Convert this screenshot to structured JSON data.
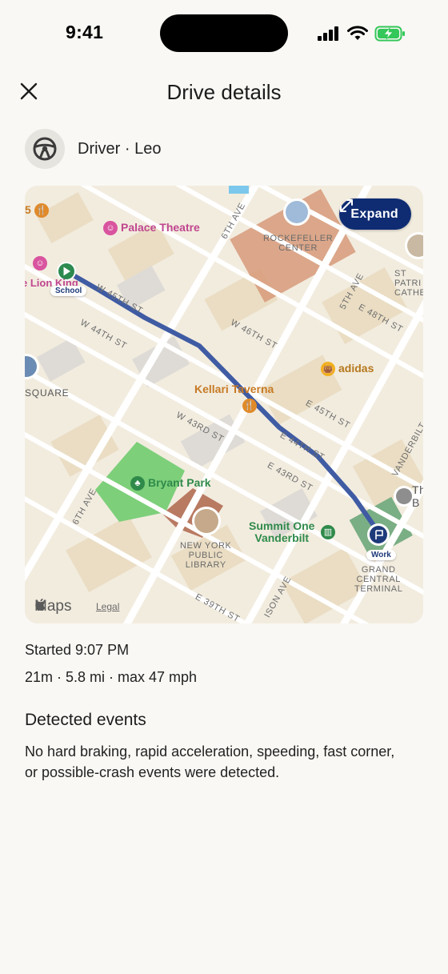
{
  "status_bar": {
    "time": "9:41"
  },
  "header": {
    "title": "Drive details"
  },
  "driver": {
    "label": "Driver · Leo"
  },
  "map": {
    "expand_label": "Expand",
    "brand": "Maps",
    "legal": "Legal",
    "route_color": "#3f5ba3",
    "streets": {
      "w45": "W 45TH ST",
      "w44": "W 44TH ST",
      "w46": "W 46TH ST",
      "e48": "E 48TH ST",
      "e45": "E 45TH ST",
      "e44": "E 44TH ST",
      "e43": "E 43RD ST",
      "w43": "W 43RD ST",
      "e39": "E 39TH ST",
      "ave6_top": "6TH AVE",
      "ave6_bottom": "6TH AVE",
      "ave5": "5TH AVE",
      "vanderbilt": "VANDERBILT AVE",
      "madison": "ISON AVE"
    },
    "pois": {
      "palace": "Palace Theatre",
      "kellari": "Kellari Taverna",
      "adidas": "adidas",
      "bryant": "Bryant Park",
      "summit_line1": "Summit One",
      "summit_line2": "Vanderbilt",
      "lion_king": "e Lion King",
      "left_five": "5",
      "square": "SQUARE"
    },
    "landmarks": {
      "rockefeller_1": "ROCKEFELLER",
      "rockefeller_2": "CENTER",
      "nypl_1": "NEW YORK",
      "nypl_2": "PUBLIC",
      "nypl_3": "LIBRARY",
      "gct_1": "GRAND",
      "gct_2": "CENTRAL",
      "gct_3": "TERMINAL",
      "patrick_1": "ST",
      "patrick_2": "PATRI",
      "patrick_3": "CATHE",
      "right_edge": "Th",
      "right_edge_2": "B"
    },
    "pins": {
      "start": "School",
      "end": "Work"
    }
  },
  "trip": {
    "started": "Started 9:07 PM",
    "stats": "21m · 5.8 mi · max 47 mph"
  },
  "events": {
    "heading": "Detected events",
    "body": "No hard braking, rapid acceleration, speeding, fast corner, or possible-crash events were detected."
  },
  "colors": {
    "background": "#f9f8f4",
    "expand_button": "#0f2c73",
    "poi_pink": "#c0468f",
    "poi_orange": "#c77a24",
    "poi_green": "#2f8a4a",
    "battery_green": "#34c759"
  }
}
